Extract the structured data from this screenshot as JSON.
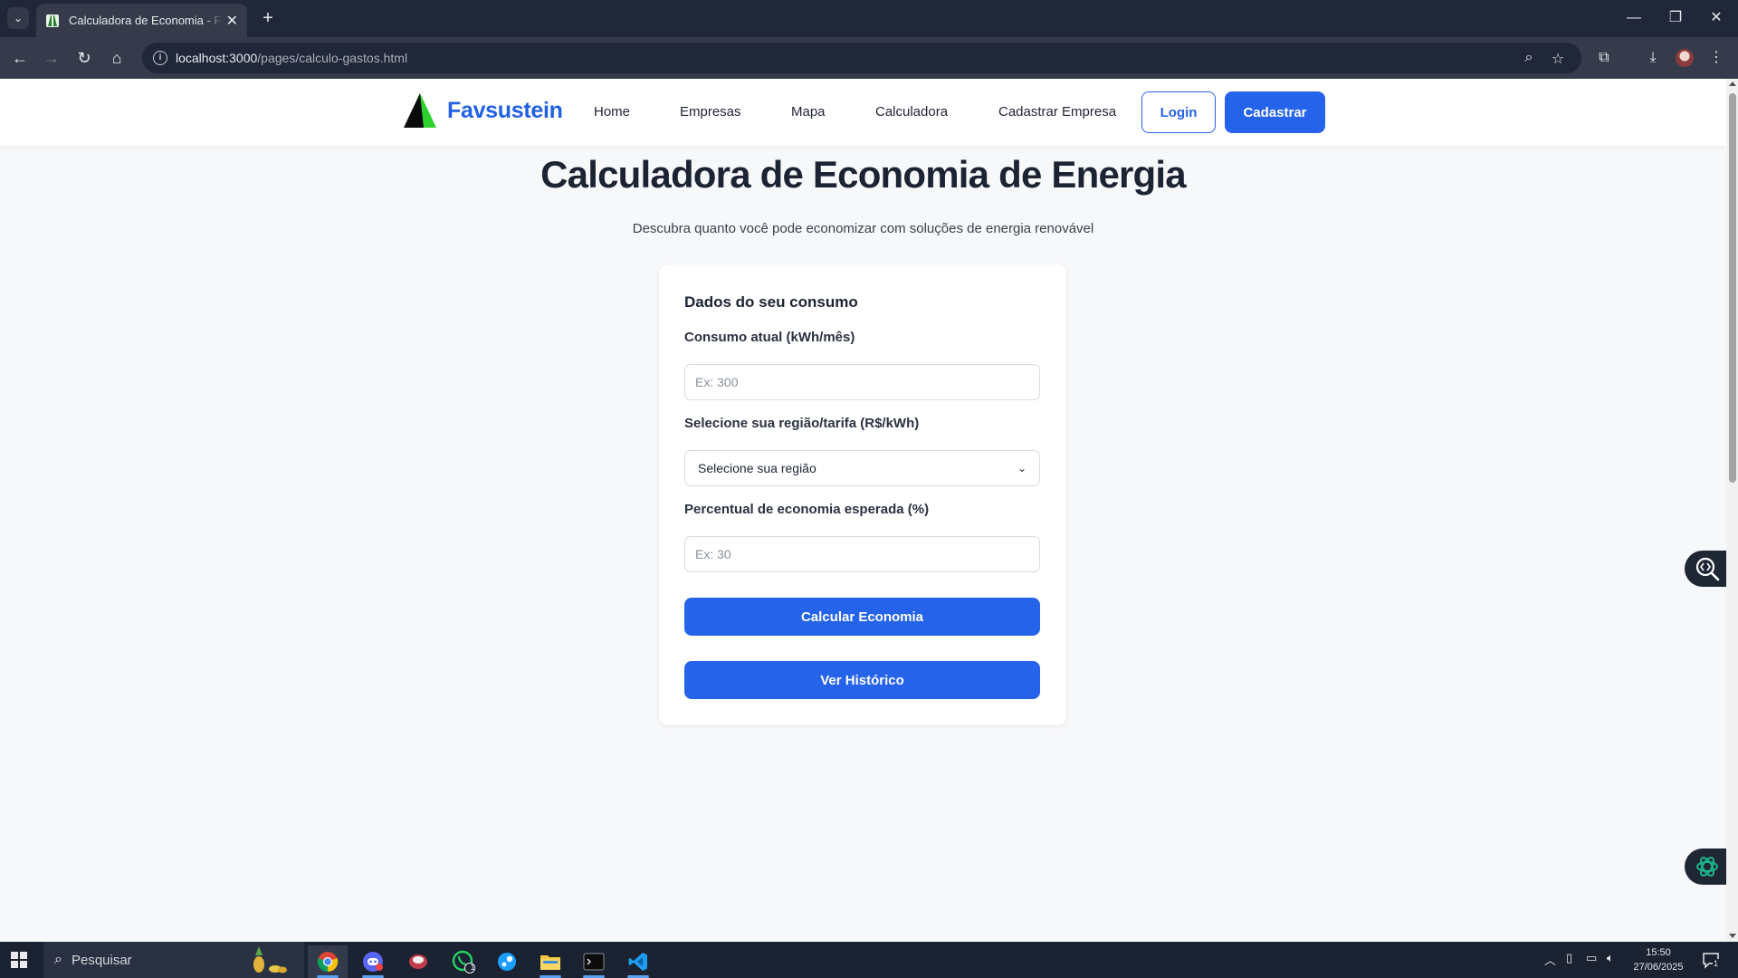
{
  "browser": {
    "tab_title": "Calculadora de Economia - Favsustein",
    "url_host": "localhost:3000",
    "url_path": "/pages/calculo-gastos.html"
  },
  "header": {
    "brand": "Favsustein",
    "nav": [
      "Home",
      "Empresas",
      "Mapa",
      "Calculadora",
      "Cadastrar Empresa"
    ],
    "login_label": "Login",
    "signup_label": "Cadastrar"
  },
  "page": {
    "title": "Calculadora de Economia de Energia",
    "subtitle": "Descubra quanto você pode economizar com soluções de energia renovável"
  },
  "form": {
    "heading": "Dados do seu consumo",
    "consumption_label": "Consumo atual (kWh/mês)",
    "consumption_placeholder": "Ex: 300",
    "region_label": "Selecione sua região/tarifa (R$/kWh)",
    "region_selected": "Selecione sua região",
    "savings_label": "Percentual de economia esperada (%)",
    "savings_placeholder": "Ex: 30",
    "calculate_label": "Calcular Economia",
    "history_label": "Ver Histórico"
  },
  "taskbar": {
    "search_placeholder": "Pesquisar",
    "time": "15:50",
    "date": "27/06/2025",
    "notification_count": "1",
    "whatsapp_badge": "1"
  },
  "colors": {
    "accent": "#2563eb",
    "brand_text": "#2160e4",
    "logo_green": "#2ed12e"
  }
}
